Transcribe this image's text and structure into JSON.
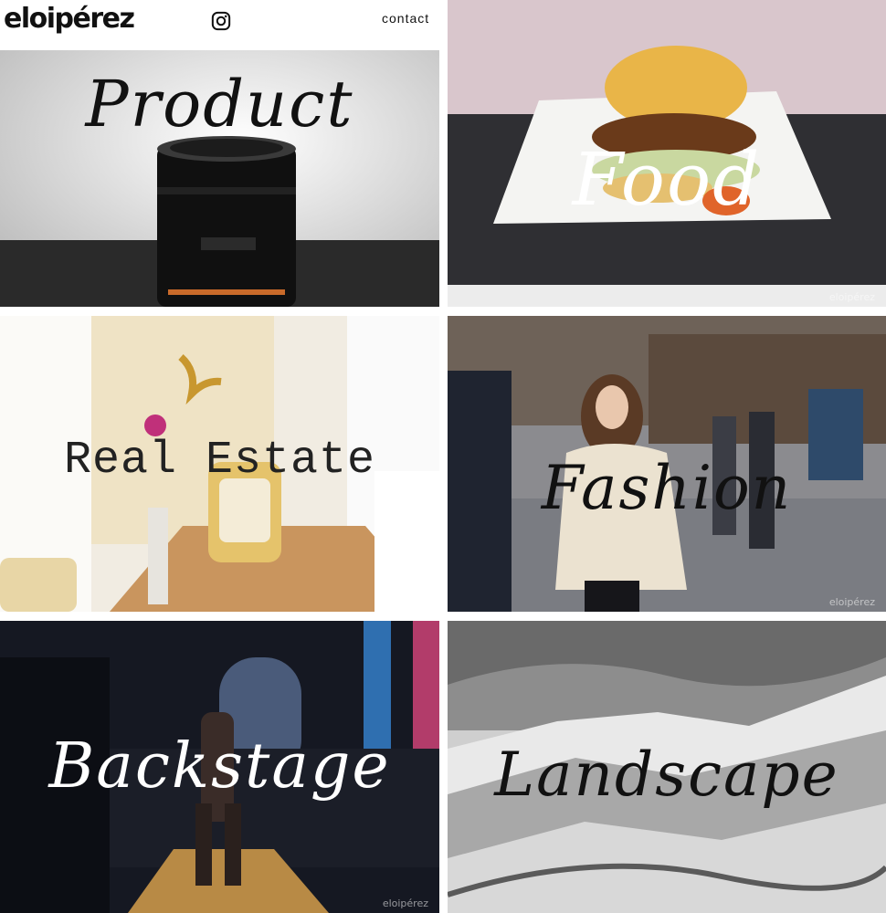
{
  "brand": {
    "logo_text": "eloipérez"
  },
  "nav": {
    "contact_label": "contact",
    "instagram_icon": "instagram-icon"
  },
  "tiles": {
    "product": {
      "label": "Product"
    },
    "food": {
      "label": "Food",
      "watermark": "eloipérez"
    },
    "realestate": {
      "label": "Real Estate"
    },
    "fashion": {
      "label": "Fashion",
      "watermark": "eloipérez"
    },
    "backstage": {
      "label": "Backstage",
      "watermark": "eloipérez"
    },
    "landscape": {
      "label": "Landscape"
    }
  }
}
